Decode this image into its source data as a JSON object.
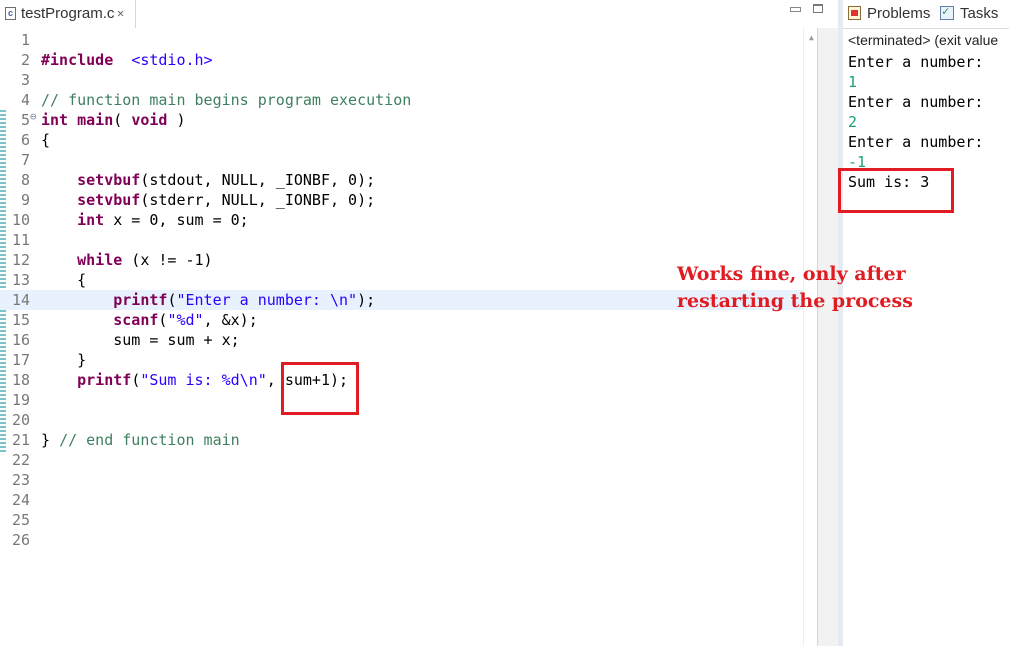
{
  "editor": {
    "tab_title": "testProgram.c",
    "lines": [
      {
        "n": "1",
        "parts": []
      },
      {
        "n": "2",
        "parts": [
          [
            "kw",
            "#include"
          ],
          [
            "",
            "  "
          ],
          [
            "inc",
            "<stdio.h>"
          ]
        ]
      },
      {
        "n": "3",
        "parts": []
      },
      {
        "n": "4",
        "parts": [
          [
            "cmt",
            "// function main begins program execution"
          ]
        ]
      },
      {
        "n": "5",
        "fold": true,
        "parts": [
          [
            "kw",
            "int"
          ],
          [
            "",
            " "
          ],
          [
            "kw",
            "main"
          ],
          [
            "",
            "( "
          ],
          [
            "kw",
            "void"
          ],
          [
            "",
            " )"
          ]
        ]
      },
      {
        "n": "6",
        "parts": [
          [
            "",
            "{"
          ]
        ]
      },
      {
        "n": "7",
        "parts": []
      },
      {
        "n": "8",
        "parts": [
          [
            "",
            "    "
          ],
          [
            "kw",
            "setvbuf"
          ],
          [
            "",
            "(stdout, NULL, _IONBF, 0);"
          ]
        ]
      },
      {
        "n": "9",
        "parts": [
          [
            "",
            "    "
          ],
          [
            "kw",
            "setvbuf"
          ],
          [
            "",
            "(stderr, NULL, _IONBF, 0);"
          ]
        ]
      },
      {
        "n": "10",
        "parts": [
          [
            "",
            "    "
          ],
          [
            "kw",
            "int"
          ],
          [
            "",
            " x = 0, sum = 0;"
          ]
        ]
      },
      {
        "n": "11",
        "parts": []
      },
      {
        "n": "12",
        "parts": [
          [
            "",
            "    "
          ],
          [
            "kw",
            "while"
          ],
          [
            "",
            " (x != -1)"
          ]
        ]
      },
      {
        "n": "13",
        "parts": [
          [
            "",
            "    {"
          ]
        ]
      },
      {
        "n": "14",
        "highlight": true,
        "parts": [
          [
            "",
            "        "
          ],
          [
            "kw",
            "printf"
          ],
          [
            "",
            "("
          ],
          [
            "str",
            "\"Enter a number: \\n\""
          ],
          [
            "",
            ");"
          ]
        ]
      },
      {
        "n": "15",
        "parts": [
          [
            "",
            "        "
          ],
          [
            "kw",
            "scanf"
          ],
          [
            "",
            "("
          ],
          [
            "str",
            "\"%d\""
          ],
          [
            "",
            ", &x);"
          ]
        ]
      },
      {
        "n": "16",
        "parts": [
          [
            "",
            "        sum = sum + x;"
          ]
        ]
      },
      {
        "n": "17",
        "parts": [
          [
            "",
            "    }"
          ]
        ]
      },
      {
        "n": "18",
        "parts": [
          [
            "",
            "    "
          ],
          [
            "kw",
            "printf"
          ],
          [
            "",
            "("
          ],
          [
            "str",
            "\"Sum is: %d\\n\""
          ],
          [
            "",
            ", sum+1);"
          ]
        ]
      },
      {
        "n": "19",
        "parts": []
      },
      {
        "n": "20",
        "parts": []
      },
      {
        "n": "21",
        "parts": [
          [
            "",
            "} "
          ],
          [
            "cmt",
            "// end function main"
          ]
        ]
      },
      {
        "n": "22",
        "parts": []
      },
      {
        "n": "23",
        "parts": []
      },
      {
        "n": "24",
        "parts": []
      },
      {
        "n": "25",
        "parts": []
      },
      {
        "n": "26",
        "parts": []
      }
    ]
  },
  "console": {
    "tabs": [
      "Problems",
      "Tasks"
    ],
    "status": "<terminated> (exit value",
    "output": [
      {
        "text": "Enter a number:",
        "type": "out"
      },
      {
        "text": "1",
        "type": "in"
      },
      {
        "text": "Enter a number:",
        "type": "out"
      },
      {
        "text": "2",
        "type": "in"
      },
      {
        "text": "Enter a number:",
        "type": "out"
      },
      {
        "text": "-1",
        "type": "in"
      },
      {
        "text": "Sum is: 3",
        "type": "out"
      }
    ]
  },
  "annotation": {
    "note_line1": "Works fine, only after",
    "note_line2": "restarting the process",
    "color": "#e01b22"
  }
}
